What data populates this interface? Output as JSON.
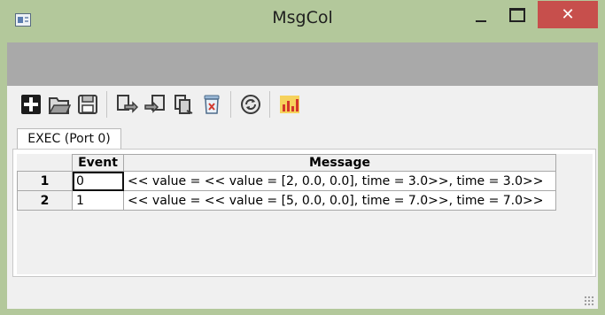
{
  "window": {
    "title": "MsgCol",
    "icons": {
      "app": "app-window-icon",
      "minimize": "minimize-icon",
      "maximize": "maximize-icon",
      "close": "close-icon"
    }
  },
  "toolbar": {
    "buttons": [
      {
        "name": "add-icon",
        "tooltip": ""
      },
      {
        "name": "open-folder-icon",
        "tooltip": ""
      },
      {
        "name": "save-icon",
        "tooltip": ""
      },
      {
        "name": "export-icon",
        "tooltip": ""
      },
      {
        "name": "import-icon",
        "tooltip": ""
      },
      {
        "name": "copy-icon",
        "tooltip": ""
      },
      {
        "name": "clear-delete-icon",
        "tooltip": ""
      },
      {
        "name": "refresh-icon",
        "tooltip": ""
      },
      {
        "name": "plot-chart-icon",
        "tooltip": ""
      }
    ],
    "colors": {
      "add": "#1c1c1c",
      "refresh": "#5a5a5a",
      "chart": "#e0b21a"
    }
  },
  "tabs": [
    {
      "label": "EXEC (Port 0)",
      "active": true
    }
  ],
  "grid": {
    "headers": [
      "Event",
      "Message"
    ],
    "rows": [
      {
        "index": "1",
        "event": "0",
        "message": "<< value = << value = [2, 0.0, 0.0], time = 3.0>>, time = 3.0>>"
      },
      {
        "index": "2",
        "event": "1",
        "message": "<< value = << value = [5, 0.0, 0.0], time = 7.0>>, time = 7.0>>"
      }
    ]
  },
  "colors": {
    "frame": "#b3c89b",
    "close_button": "#c74f4c",
    "gray_strip": "#a9a9a9"
  }
}
